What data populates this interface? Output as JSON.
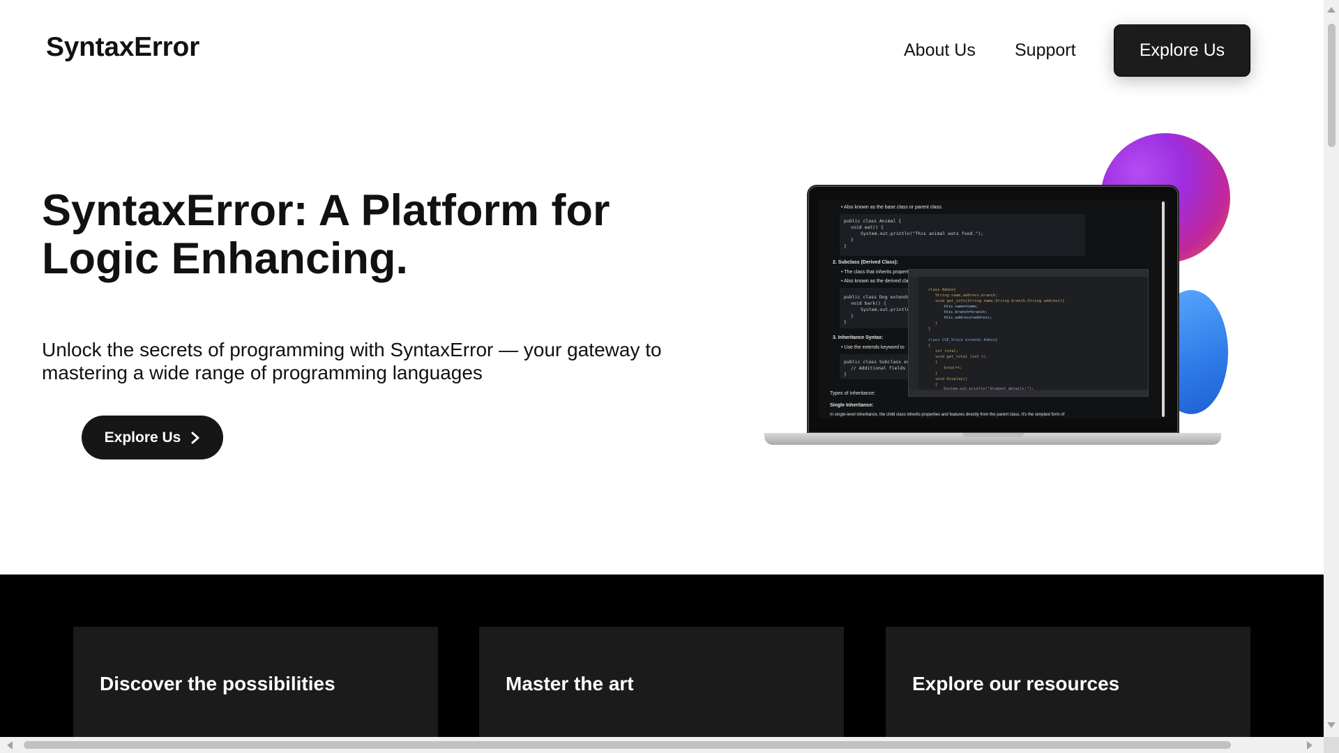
{
  "header": {
    "brand": "SyntaxError",
    "nav": {
      "about": "About Us",
      "support": "Support",
      "cta": "Explore Us"
    }
  },
  "hero": {
    "title": "SyntaxError: A Platform for Logic Enhancing.",
    "subtitle": "Unlock the secrets of programming with SyntaxError — your gateway to mastering a wide range of programming languages",
    "cta": "Explore Us",
    "cta_icon": "chevron-right-icon"
  },
  "illustration": {
    "doc_lines": {
      "l1": "• Also known as the base class or parent class.",
      "l2": "public class Animal {",
      "l3": "void eat() {",
      "l4": "System.out.println(\"This animal eats food.\");",
      "l5": "}",
      "l6": "}",
      "l7": "2. Subclass (Derived Class):",
      "l8": "• The class that inherits properti",
      "l9": "• Also known as the derived clas",
      "l10": "public class Dog extends A",
      "l11": "void bark() {",
      "l12": "System.out.println",
      "l13": "}",
      "l14": "}",
      "l15": "3. Inheritance Syntax:",
      "l16": "• Use the extends keyword to",
      "l17": "public class Subclass exte",
      "l18": "// Additional fields a",
      "l19": "}",
      "l20": "Types of Inheritance:",
      "l21": "Single Inheritance:",
      "l22": "In single-level inheritance, the child class inherits properties and features directly from the parent class. It's the simplest form of"
    },
    "editor_lines": {
      "e1": "class Admin{",
      "e2": "String name,address,branch;",
      "e3": "void get_info(String name,String branch,String address){",
      "e4": "this.name=name;",
      "e5": "this.branch=branch;",
      "e6": "this.address=address;",
      "e7": "}",
      "e8": "}",
      "e9": "class CSE_block extends Admin{",
      "e10": "{",
      "e11": "int total;",
      "e12": "void get_total (int t)",
      "e13": "{",
      "e14": "total=t;",
      "e15": "}",
      "e16": "void Display()",
      "e17": "{",
      "e18": "System.out.println(\"Student details:\");"
    }
  },
  "features": [
    {
      "title": "Discover the possibilities"
    },
    {
      "title": "Master the art"
    },
    {
      "title": "Explore our resources"
    }
  ],
  "colors": {
    "dark_button": "#1c1c1c",
    "dark_section": "#000000",
    "card_bg": "#1b1b1b"
  }
}
